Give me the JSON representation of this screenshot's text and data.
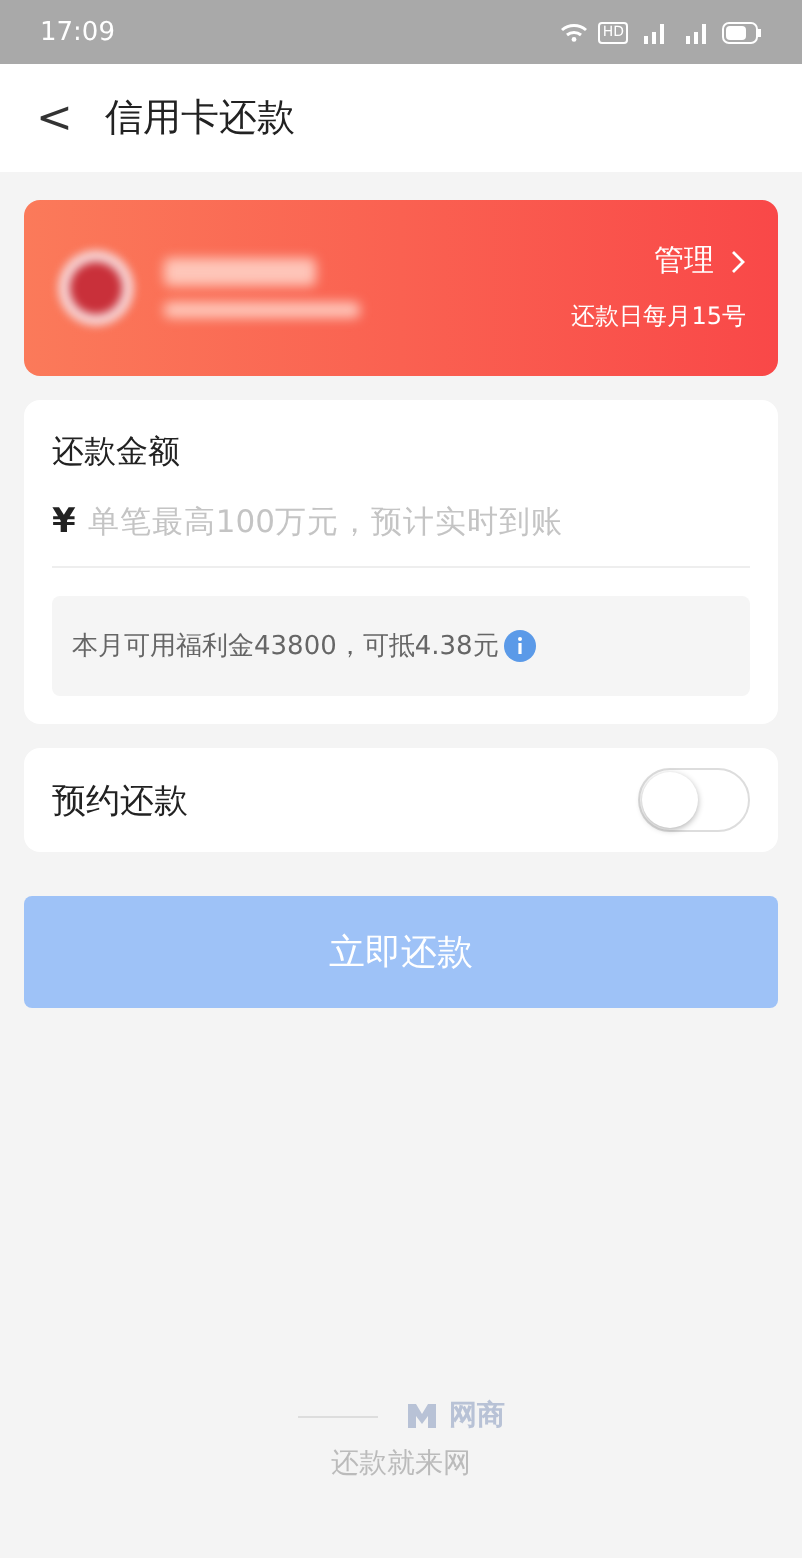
{
  "status_bar": {
    "time": "17:09",
    "badge": "HD"
  },
  "header": {
    "back": "<",
    "title": "信用卡还款"
  },
  "card": {
    "manage": "管理",
    "due": "还款日每月15号"
  },
  "amount": {
    "label": "还款金额",
    "currency": "¥",
    "placeholder": "单笔最高100万元，预计实时到账",
    "benefit": "本月可用福利金43800，可抵4.38元"
  },
  "scheduled": {
    "label": "预约还款",
    "on": false
  },
  "submit": {
    "label": "立即还款",
    "disabled": true
  },
  "footer": {
    "brand": "网商",
    "slogan": "还款就来网"
  }
}
